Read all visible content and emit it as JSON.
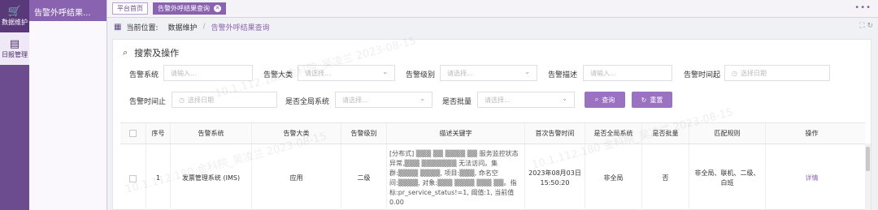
{
  "left_nav": {
    "items": [
      {
        "label": "数据维护",
        "icon": "cart-chart-icon"
      },
      {
        "label": "日报管理",
        "icon": "document-icon"
      }
    ]
  },
  "submenu": {
    "active_label": "告警外呼结果..."
  },
  "tabs": [
    {
      "label": "平台首页"
    },
    {
      "label": "告警外呼结果查询"
    }
  ],
  "topbar": {
    "more_symbol": "•••"
  },
  "breadcrumb": {
    "prefix": "当前位置:",
    "parent": "数据维护",
    "separator": "/",
    "current": "告警外呼结果查询"
  },
  "search": {
    "title": "搜索及操作",
    "fields": {
      "alarm_system": {
        "label": "告警系统",
        "placeholder": "请输入..."
      },
      "alarm_category": {
        "label": "告警大类",
        "placeholder": "请选择..."
      },
      "alarm_level": {
        "label": "告警级别",
        "placeholder": "请选择..."
      },
      "alarm_desc": {
        "label": "告警描述",
        "placeholder": "请输入..."
      },
      "time_start": {
        "label": "告警时间起",
        "placeholder": "选择日期"
      },
      "time_end": {
        "label": "告警时间止",
        "placeholder": "选择日期"
      },
      "global_system": {
        "label": "是否全局系统",
        "placeholder": "请选择..."
      },
      "batch": {
        "label": "是否批量",
        "placeholder": "请选择..."
      }
    },
    "query_button": "查询",
    "reset_button": "重置"
  },
  "table": {
    "headers": [
      "",
      "序号",
      "告警系统",
      "告警大类",
      "告警级别",
      "描述关键字",
      "首次告警时间",
      "是否全局系统",
      "是否批量",
      "匹配规则",
      "操作"
    ],
    "rows": [
      {
        "index": "1",
        "system": "发票管理系统 (IMS)",
        "category": "应用",
        "level": "二级",
        "desc": "[分布式] ▒▒▒ ▒▒ ▒▒▒▒ ▒▒ 服务监控状态异常,▒▒▒ ▒▒▒▒▒▒▒ 无法访问。集群:▒▒▒▒ ▒▒▒▒, 项目:▒▒▒, 命名空间:▒▒▒▒, 对象:▒▒▒ ▒▒▒▒ ▒▒▒ ▒▒。指标:pr_service_status!=1, 阈值:1, 当前值0.00",
        "first_time": "2023年08月03日 15:50:20",
        "global": "非全局",
        "batch": "否",
        "rule": "非全局、联机、二级、白班",
        "action": "详情"
      }
    ]
  },
  "watermark": "10.1.112.180 金科院_吴凌兰 2023-08-15"
}
